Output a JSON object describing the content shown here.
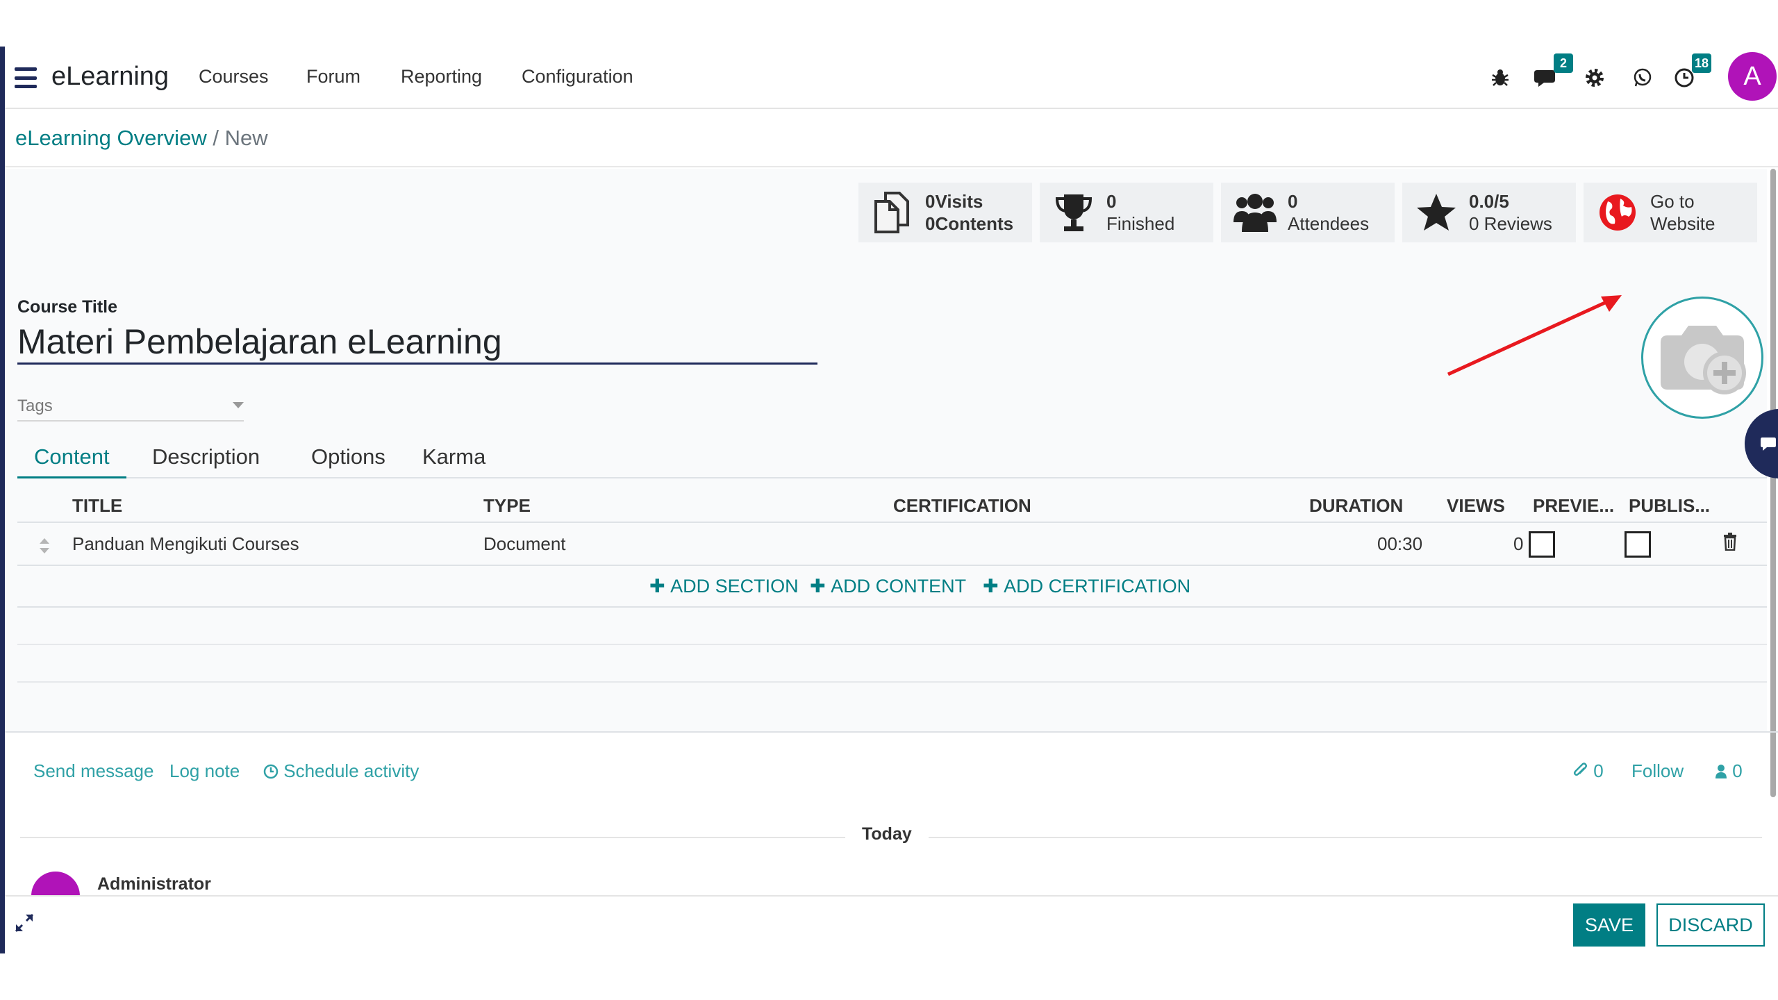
{
  "navbar": {
    "app_title": "eLearning",
    "menu": [
      "Courses",
      "Forum",
      "Reporting",
      "Configuration"
    ],
    "messages_badge": "2",
    "activities_badge": "18",
    "avatar_letter": "A"
  },
  "breadcrumb": {
    "parent": "eLearning Overview",
    "separator": "/",
    "current": "New"
  },
  "stat_buttons": [
    {
      "line1": "0Visits",
      "line2": "0Contents",
      "icon": "documents-icon"
    },
    {
      "line1": "0",
      "line2": "Finished",
      "icon": "trophy-icon"
    },
    {
      "line1": "0",
      "line2": "Attendees",
      "icon": "users-icon"
    },
    {
      "line1": "0.0/5",
      "line2": "0 Reviews",
      "icon": "star-icon"
    },
    {
      "line1": "Go to",
      "line2": "Website",
      "icon": "globe-icon"
    }
  ],
  "form": {
    "course_title_label": "Course Title",
    "course_title_value": "Materi Pembelajaran eLearning",
    "tags_placeholder": "Tags"
  },
  "tabs": [
    "Content",
    "Description",
    "Options",
    "Karma"
  ],
  "active_tab": "Content",
  "table": {
    "headers": [
      "TITLE",
      "TYPE",
      "CERTIFICATION",
      "DURATION",
      "VIEWS",
      "PREVIE...",
      "PUBLIS..."
    ],
    "rows": [
      {
        "title": "Panduan Mengikuti Courses",
        "type": "Document",
        "certification": "",
        "duration": "00:30",
        "views": "0",
        "preview": false,
        "published": false
      }
    ],
    "add_section": "ADD SECTION",
    "add_content": "ADD CONTENT",
    "add_certification": "ADD CERTIFICATION"
  },
  "chatter": {
    "send_message": "Send message",
    "log_note": "Log note",
    "schedule_activity": "Schedule activity",
    "attachments_count": "0",
    "follow": "Follow",
    "followers_count": "0",
    "today": "Today",
    "author": "Administrator"
  },
  "footer": {
    "save": "SAVE",
    "discard": "DISCARD"
  },
  "colors": {
    "primary": "#017e84",
    "accent_link": "#2fa1a6",
    "avatar": "#b013b8",
    "annotation_arrow": "#e8191f"
  }
}
